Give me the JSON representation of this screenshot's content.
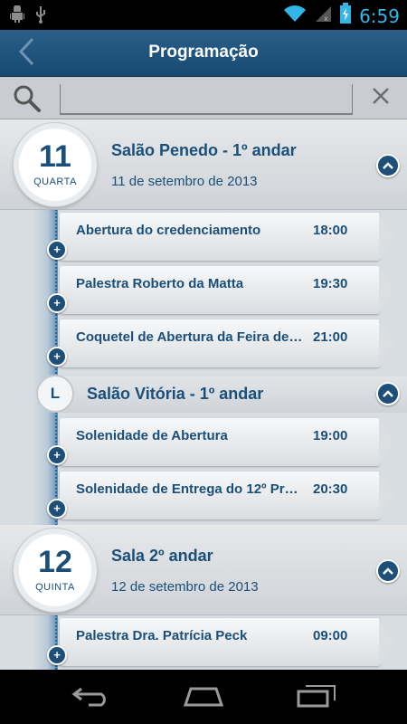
{
  "status_bar": {
    "time": "6:59"
  },
  "header": {
    "title": "Programação"
  },
  "search": {
    "placeholder": "",
    "value": ""
  },
  "groups": [
    {
      "day_number": "11",
      "weekday": "QUARTA",
      "venue": "Salão Penedo - 1º andar",
      "date_text": "11 de setembro de 2013",
      "events": [
        {
          "title": "Abertura do credenciamento",
          "time": "18:00"
        },
        {
          "title": "Palestra Roberto da Matta",
          "time": "19:30"
        },
        {
          "title": "Coquetel de Abertura da Feira de…",
          "time": "21:00"
        }
      ],
      "sub_section": {
        "letter": "L",
        "venue": "Salão Vitória - 1º andar",
        "events": [
          {
            "title": "Solenidade de Abertura",
            "time": "19:00"
          },
          {
            "title": "Solenidade de Entrega do 12º Pr…",
            "time": "20:30"
          }
        ]
      }
    },
    {
      "day_number": "12",
      "weekday": "QUINTA",
      "venue": "Sala 2º andar",
      "date_text": "12 de setembro de 2013",
      "events": [
        {
          "title": "Palestra Dra. Patrícia Peck",
          "time": "09:00"
        }
      ]
    }
  ],
  "colors": {
    "header": "#1d4f78",
    "accent_text": "#1a4f7a",
    "status_icons": "#33b5e5"
  },
  "icons": [
    "android-debug-icon",
    "usb-icon",
    "wifi-icon",
    "signal-icon",
    "battery-charging-icon",
    "back-icon",
    "search-icon",
    "clear-icon",
    "collapse-icon",
    "add-icon",
    "nav-back-icon",
    "nav-home-icon",
    "nav-recent-icon"
  ]
}
